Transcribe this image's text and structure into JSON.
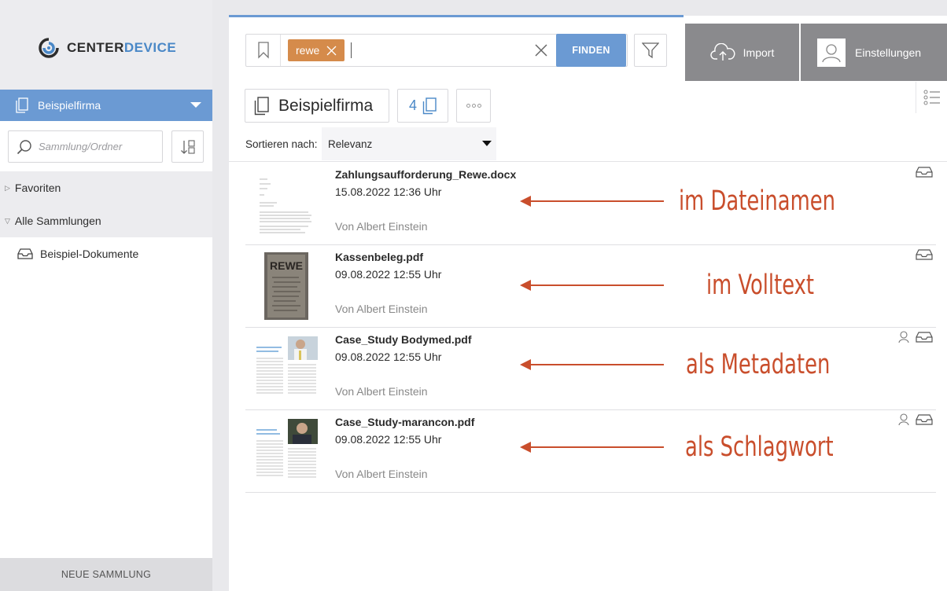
{
  "logo": {
    "part1": "CENTER",
    "part2": "DEVICE"
  },
  "sidebar": {
    "company": "Beispielfirma",
    "search_placeholder": "Sammlung/Ordner",
    "tree": [
      {
        "label": "Favoriten"
      },
      {
        "label": "Alle Sammlungen"
      }
    ],
    "collections": [
      {
        "label": "Beispiel-Dokumente"
      }
    ],
    "new_collection": "NEUE SAMMLUNG"
  },
  "search": {
    "tag": "rewe",
    "find_label": "FINDEN"
  },
  "top_buttons": {
    "import": "Import",
    "settings": "Einstellungen"
  },
  "breadcrumb": {
    "folder": "Beispielfirma",
    "count": "4"
  },
  "sort": {
    "label": "Sortieren nach:",
    "value": "Relevanz"
  },
  "documents": [
    {
      "title": "Zahlungsaufforderung_Rewe.docx",
      "date": "15.08.2022 12:36 Uhr",
      "author": "Von Albert Einstein"
    },
    {
      "title": "Kassenbeleg.pdf",
      "date": "09.08.2022 12:55 Uhr",
      "author": "Von Albert Einstein",
      "thumb_text": "REWE"
    },
    {
      "title": "Case_Study Bodymed.pdf",
      "date": "09.08.2022 12:55 Uhr",
      "author": "Von Albert Einstein"
    },
    {
      "title": "Case_Study-marancon.pdf",
      "date": "09.08.2022 12:55 Uhr",
      "author": "Von Albert Einstein"
    }
  ],
  "annotations": [
    {
      "text": "im Dateinamen"
    },
    {
      "text": "im Volltext"
    },
    {
      "text": "als Metadaten"
    },
    {
      "text": "als Schlagwort"
    }
  ],
  "colors": {
    "accent": "#6b9ad3",
    "tag": "#d58b4b",
    "annotation": "#c94e2c",
    "gray_button": "#8a8a8d"
  }
}
